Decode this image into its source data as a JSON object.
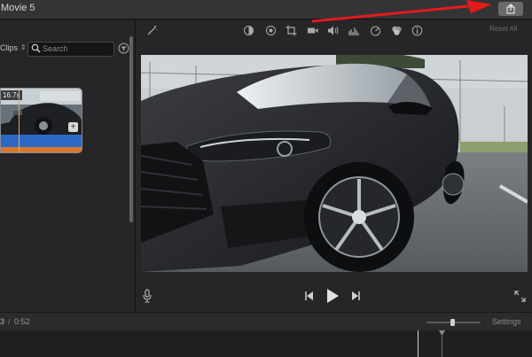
{
  "window": {
    "title": "Movie 5"
  },
  "browser": {
    "clips_label": "Clips",
    "search_placeholder": "Search",
    "clip": {
      "duration": "16.7s",
      "add_symbol": "+"
    }
  },
  "viewer": {
    "toolbar_icons": [
      "magic-wand-icon",
      "color-balance-icon",
      "color-correction-icon",
      "crop-icon",
      "stabilization-icon",
      "volume-icon",
      "noise-reduction-icon",
      "speed-icon",
      "clip-filter-icon",
      "info-icon"
    ],
    "reset_all_label": "Reset All",
    "controls": [
      "microphone-icon",
      "skip-back-icon",
      "play-icon",
      "skip-forward-icon",
      "fullscreen-icon"
    ]
  },
  "timeline": {
    "current_time": "3",
    "separator": "/",
    "total_time": "0:52",
    "zoom_level": 0.49,
    "settings_label": "Settings"
  },
  "colors": {
    "share_button": "#6a6a6c",
    "annotation_arrow": "#e31b1b",
    "clip_audio_bar": "#2e68c7",
    "clip_selection_bar": "#d57b2d"
  }
}
